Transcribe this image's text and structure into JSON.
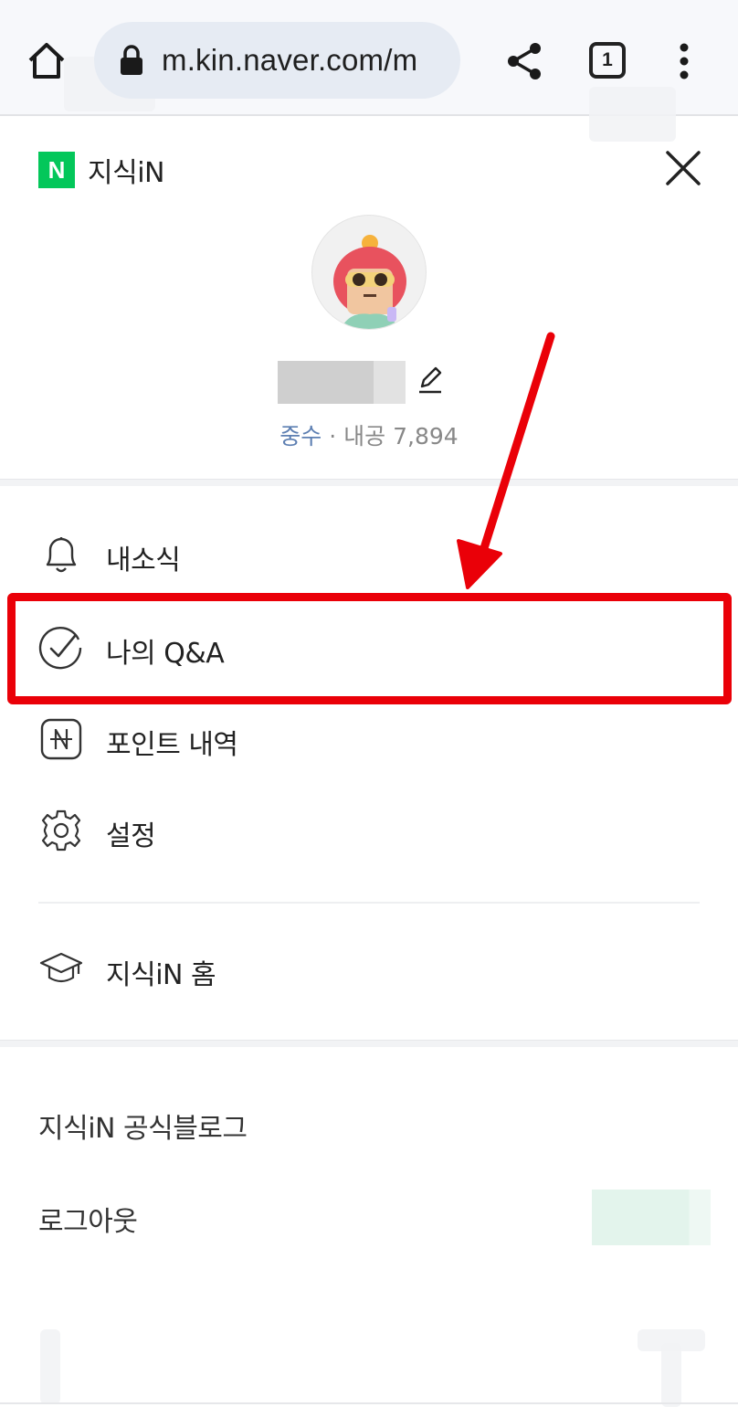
{
  "browser": {
    "url": "m.kin.naver.com/m",
    "tab_count": "1"
  },
  "header": {
    "logo_letter": "N",
    "title": "지식iN"
  },
  "profile": {
    "grade": "중수",
    "separator": " · ",
    "points_label": "내공 7,894"
  },
  "menu": {
    "items": [
      {
        "label": "내소식",
        "icon": "bell-icon"
      },
      {
        "label": "나의 Q&A",
        "icon": "check-circle-icon"
      },
      {
        "label": "포인트 내역",
        "icon": "point-icon"
      },
      {
        "label": "설정",
        "icon": "gear-icon"
      },
      {
        "label": "지식iN 홈",
        "icon": "graduation-cap-icon"
      }
    ]
  },
  "links": {
    "blog": "지식iN 공식블로그",
    "logout": "로그아웃"
  },
  "colors": {
    "brand_green": "#03c75a",
    "annotation_red": "#ea0008",
    "grade_blue": "#5d7fb2"
  }
}
